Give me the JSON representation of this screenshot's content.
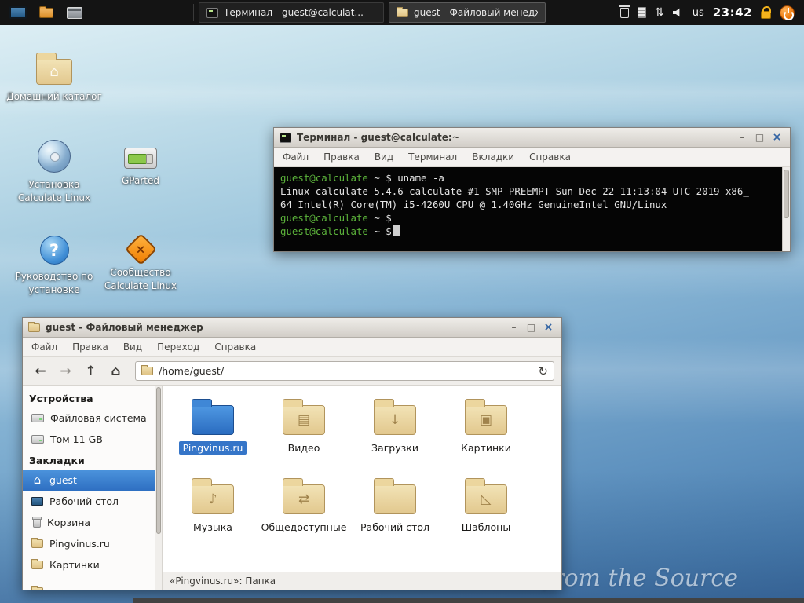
{
  "colors": {
    "selection_blue": "#3575c8",
    "terminal_green": "#5cb33b",
    "panel_bg": "#141414",
    "folder_tan": "#e2c88e",
    "folder_selected_blue": "#2a6cc0",
    "titlebar_gray": "#d2cec8"
  },
  "icons": {
    "minimize": "–",
    "maximize": "□",
    "close": "×",
    "back": "←",
    "forward": "→",
    "up": "↑",
    "home": "⌂",
    "refresh": "↻",
    "network": "⇅",
    "question_mark": "?",
    "community_x": "×"
  },
  "panel": {
    "windows": [
      {
        "title": "Терминал - guest@calculat...",
        "active": false
      },
      {
        "title": "guest - Файловый менедж...",
        "active": true
      }
    ],
    "keyboard_layout": "us",
    "clock": "23:42"
  },
  "desktop": {
    "slogan": "Linux from the Source",
    "icons": [
      {
        "label": "Домашний каталог"
      },
      {
        "label": "Установка Calculate Linux"
      },
      {
        "label": "GParted"
      },
      {
        "label": "Руководство по установке"
      },
      {
        "label": "Сообщество Calculate Linux"
      }
    ]
  },
  "terminal": {
    "title": "Терминал - guest@calculate:~",
    "menu": [
      "Файл",
      "Правка",
      "Вид",
      "Терминал",
      "Вкладки",
      "Справка"
    ],
    "lines": [
      {
        "user": "guest@calculate",
        "suffix": " ~ $ ",
        "cmd": "uname -a"
      },
      {
        "text": "Linux calculate 5.4.6-calculate #1 SMP PREEMPT Sun Dec 22 11:13:04 UTC 2019 x86_"
      },
      {
        "text": "64 Intel(R) Core(TM) i5-4260U CPU @ 1.40GHz GenuineIntel GNU/Linux"
      },
      {
        "user": "guest@calculate",
        "suffix": " ~ $"
      },
      {
        "user": "guest@calculate",
        "suffix": " ~ $"
      }
    ]
  },
  "file_manager": {
    "title": "guest - Файловый менеджер",
    "menu": [
      "Файл",
      "Правка",
      "Вид",
      "Переход",
      "Справка"
    ],
    "path": "/home/guest/",
    "sidebar": {
      "devices_header": "Устройства",
      "devices": [
        {
          "label": "Файловая система",
          "icon": "drive-icon"
        },
        {
          "label": "Том 11 GB",
          "icon": "drive-icon"
        }
      ],
      "bookmarks_header": "Закладки",
      "bookmarks": [
        {
          "label": "guest",
          "icon": "home-icon",
          "selected": true
        },
        {
          "label": "Рабочий стол",
          "icon": "desktop-icon"
        },
        {
          "label": "Корзина",
          "icon": "trash-icon"
        },
        {
          "label": "Pingvinus.ru",
          "icon": "folder-icon"
        },
        {
          "label": "Картинки",
          "icon": "folder-icon"
        }
      ]
    },
    "folders": [
      {
        "name": "Pingvinus.ru",
        "selected": true,
        "emblem": ""
      },
      {
        "name": "Видео",
        "emblem": "▤"
      },
      {
        "name": "Загрузки",
        "emblem": "↓"
      },
      {
        "name": "Картинки",
        "emblem": "▣"
      },
      {
        "name": "Музыка",
        "emblem": "♪"
      },
      {
        "name": "Общедоступные",
        "emblem": "⇄"
      },
      {
        "name": "Рабочий стол",
        "emblem": ""
      },
      {
        "name": "Шаблоны",
        "emblem": "◺"
      }
    ],
    "statusbar": "«Pingvinus.ru»: Папка"
  }
}
